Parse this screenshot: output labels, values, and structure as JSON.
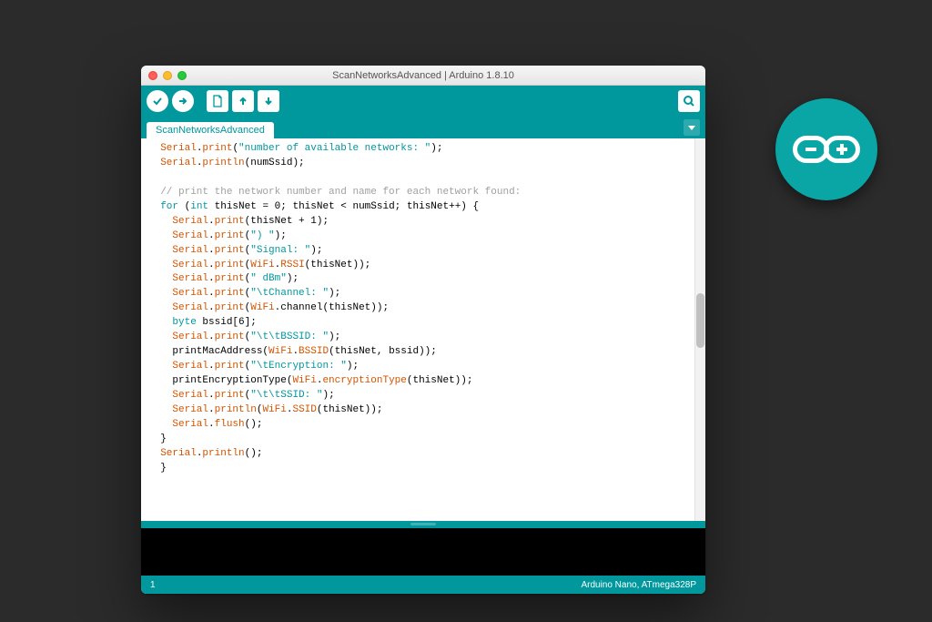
{
  "window": {
    "title": "ScanNetworksAdvanced | Arduino 1.8.10"
  },
  "toolbar": {
    "verify_title": "Verify",
    "upload_title": "Upload",
    "new_title": "New",
    "open_title": "Open",
    "save_title": "Save",
    "monitor_title": "Serial Monitor"
  },
  "tab": {
    "name": "ScanNetworksAdvanced",
    "menu_title": "Tab menu"
  },
  "editor": {
    "lines": [
      [
        {
          "c": "c-class",
          "t": "Serial"
        },
        {
          "c": "c-punct",
          "t": "."
        },
        {
          "c": "c-method",
          "t": "print"
        },
        {
          "c": "c-punct",
          "t": "("
        },
        {
          "c": "c-str",
          "t": "\"number of available networks: \""
        },
        {
          "c": "c-punct",
          "t": ");"
        }
      ],
      [
        {
          "c": "c-class",
          "t": "Serial"
        },
        {
          "c": "c-punct",
          "t": "."
        },
        {
          "c": "c-method",
          "t": "println"
        },
        {
          "c": "c-punct",
          "t": "(numSsid);"
        }
      ],
      [],
      [
        {
          "c": "c-comment",
          "t": "// print the network number and name for each network found:"
        }
      ],
      [
        {
          "c": "c-kw",
          "t": "for "
        },
        {
          "c": "c-punct",
          "t": "("
        },
        {
          "c": "c-kw",
          "t": "int"
        },
        {
          "c": "c-punct",
          "t": " thisNet = "
        },
        {
          "c": "c-num",
          "t": "0"
        },
        {
          "c": "c-punct",
          "t": "; thisNet < numSsid; thisNet++) {"
        }
      ],
      [
        {
          "c": "c-punct",
          "t": "  "
        },
        {
          "c": "c-class",
          "t": "Serial"
        },
        {
          "c": "c-punct",
          "t": "."
        },
        {
          "c": "c-method",
          "t": "print"
        },
        {
          "c": "c-punct",
          "t": "(thisNet + 1);"
        }
      ],
      [
        {
          "c": "c-punct",
          "t": "  "
        },
        {
          "c": "c-class",
          "t": "Serial"
        },
        {
          "c": "c-punct",
          "t": "."
        },
        {
          "c": "c-method",
          "t": "print"
        },
        {
          "c": "c-punct",
          "t": "("
        },
        {
          "c": "c-str",
          "t": "\") \""
        },
        {
          "c": "c-punct",
          "t": ");"
        }
      ],
      [
        {
          "c": "c-punct",
          "t": "  "
        },
        {
          "c": "c-class",
          "t": "Serial"
        },
        {
          "c": "c-punct",
          "t": "."
        },
        {
          "c": "c-method",
          "t": "print"
        },
        {
          "c": "c-punct",
          "t": "("
        },
        {
          "c": "c-str",
          "t": "\"Signal: \""
        },
        {
          "c": "c-punct",
          "t": ");"
        }
      ],
      [
        {
          "c": "c-punct",
          "t": "  "
        },
        {
          "c": "c-class",
          "t": "Serial"
        },
        {
          "c": "c-punct",
          "t": "."
        },
        {
          "c": "c-method",
          "t": "print"
        },
        {
          "c": "c-punct",
          "t": "("
        },
        {
          "c": "c-class",
          "t": "WiFi"
        },
        {
          "c": "c-punct",
          "t": "."
        },
        {
          "c": "c-method",
          "t": "RSSI"
        },
        {
          "c": "c-punct",
          "t": "(thisNet));"
        }
      ],
      [
        {
          "c": "c-punct",
          "t": "  "
        },
        {
          "c": "c-class",
          "t": "Serial"
        },
        {
          "c": "c-punct",
          "t": "."
        },
        {
          "c": "c-method",
          "t": "print"
        },
        {
          "c": "c-punct",
          "t": "("
        },
        {
          "c": "c-str",
          "t": "\" dBm\""
        },
        {
          "c": "c-punct",
          "t": ");"
        }
      ],
      [
        {
          "c": "c-punct",
          "t": "  "
        },
        {
          "c": "c-class",
          "t": "Serial"
        },
        {
          "c": "c-punct",
          "t": "."
        },
        {
          "c": "c-method",
          "t": "print"
        },
        {
          "c": "c-punct",
          "t": "("
        },
        {
          "c": "c-str",
          "t": "\"\\tChannel: \""
        },
        {
          "c": "c-punct",
          "t": ");"
        }
      ],
      [
        {
          "c": "c-punct",
          "t": "  "
        },
        {
          "c": "c-class",
          "t": "Serial"
        },
        {
          "c": "c-punct",
          "t": "."
        },
        {
          "c": "c-method",
          "t": "print"
        },
        {
          "c": "c-punct",
          "t": "("
        },
        {
          "c": "c-class",
          "t": "WiFi"
        },
        {
          "c": "c-punct",
          "t": ".channel(thisNet));"
        }
      ],
      [
        {
          "c": "c-punct",
          "t": "  "
        },
        {
          "c": "c-kw",
          "t": "byte"
        },
        {
          "c": "c-punct",
          "t": " bssid[6];"
        }
      ],
      [
        {
          "c": "c-punct",
          "t": "  "
        },
        {
          "c": "c-class",
          "t": "Serial"
        },
        {
          "c": "c-punct",
          "t": "."
        },
        {
          "c": "c-method",
          "t": "print"
        },
        {
          "c": "c-punct",
          "t": "("
        },
        {
          "c": "c-str",
          "t": "\"\\t\\tBSSID: \""
        },
        {
          "c": "c-punct",
          "t": ");"
        }
      ],
      [
        {
          "c": "c-punct",
          "t": "  printMacAddress("
        },
        {
          "c": "c-class",
          "t": "WiFi"
        },
        {
          "c": "c-punct",
          "t": "."
        },
        {
          "c": "c-method",
          "t": "BSSID"
        },
        {
          "c": "c-punct",
          "t": "(thisNet, bssid));"
        }
      ],
      [
        {
          "c": "c-punct",
          "t": "  "
        },
        {
          "c": "c-class",
          "t": "Serial"
        },
        {
          "c": "c-punct",
          "t": "."
        },
        {
          "c": "c-method",
          "t": "print"
        },
        {
          "c": "c-punct",
          "t": "("
        },
        {
          "c": "c-str",
          "t": "\"\\tEncryption: \""
        },
        {
          "c": "c-punct",
          "t": ");"
        }
      ],
      [
        {
          "c": "c-punct",
          "t": "  printEncryptionType("
        },
        {
          "c": "c-class",
          "t": "WiFi"
        },
        {
          "c": "c-punct",
          "t": "."
        },
        {
          "c": "c-method",
          "t": "encryptionType"
        },
        {
          "c": "c-punct",
          "t": "(thisNet));"
        }
      ],
      [
        {
          "c": "c-punct",
          "t": "  "
        },
        {
          "c": "c-class",
          "t": "Serial"
        },
        {
          "c": "c-punct",
          "t": "."
        },
        {
          "c": "c-method",
          "t": "print"
        },
        {
          "c": "c-punct",
          "t": "("
        },
        {
          "c": "c-str",
          "t": "\"\\t\\tSSID: \""
        },
        {
          "c": "c-punct",
          "t": ");"
        }
      ],
      [
        {
          "c": "c-punct",
          "t": "  "
        },
        {
          "c": "c-class",
          "t": "Serial"
        },
        {
          "c": "c-punct",
          "t": "."
        },
        {
          "c": "c-method",
          "t": "println"
        },
        {
          "c": "c-punct",
          "t": "("
        },
        {
          "c": "c-class",
          "t": "WiFi"
        },
        {
          "c": "c-punct",
          "t": "."
        },
        {
          "c": "c-method",
          "t": "SSID"
        },
        {
          "c": "c-punct",
          "t": "(thisNet));"
        }
      ],
      [
        {
          "c": "c-punct",
          "t": "  "
        },
        {
          "c": "c-class",
          "t": "Serial"
        },
        {
          "c": "c-punct",
          "t": "."
        },
        {
          "c": "c-method",
          "t": "flush"
        },
        {
          "c": "c-punct",
          "t": "();"
        }
      ],
      [
        {
          "c": "c-punct",
          "t": "}"
        }
      ],
      [
        {
          "c": "c-class",
          "t": "Serial"
        },
        {
          "c": "c-punct",
          "t": "."
        },
        {
          "c": "c-method",
          "t": "println"
        },
        {
          "c": "c-punct",
          "t": "();"
        }
      ],
      [
        {
          "c": "c-punct",
          "t": "}"
        }
      ]
    ],
    "indentPrefix": "  "
  },
  "status": {
    "left": "1",
    "right": "Arduino Nano, ATmega328P"
  },
  "logo": {
    "name": "arduino-logo"
  }
}
